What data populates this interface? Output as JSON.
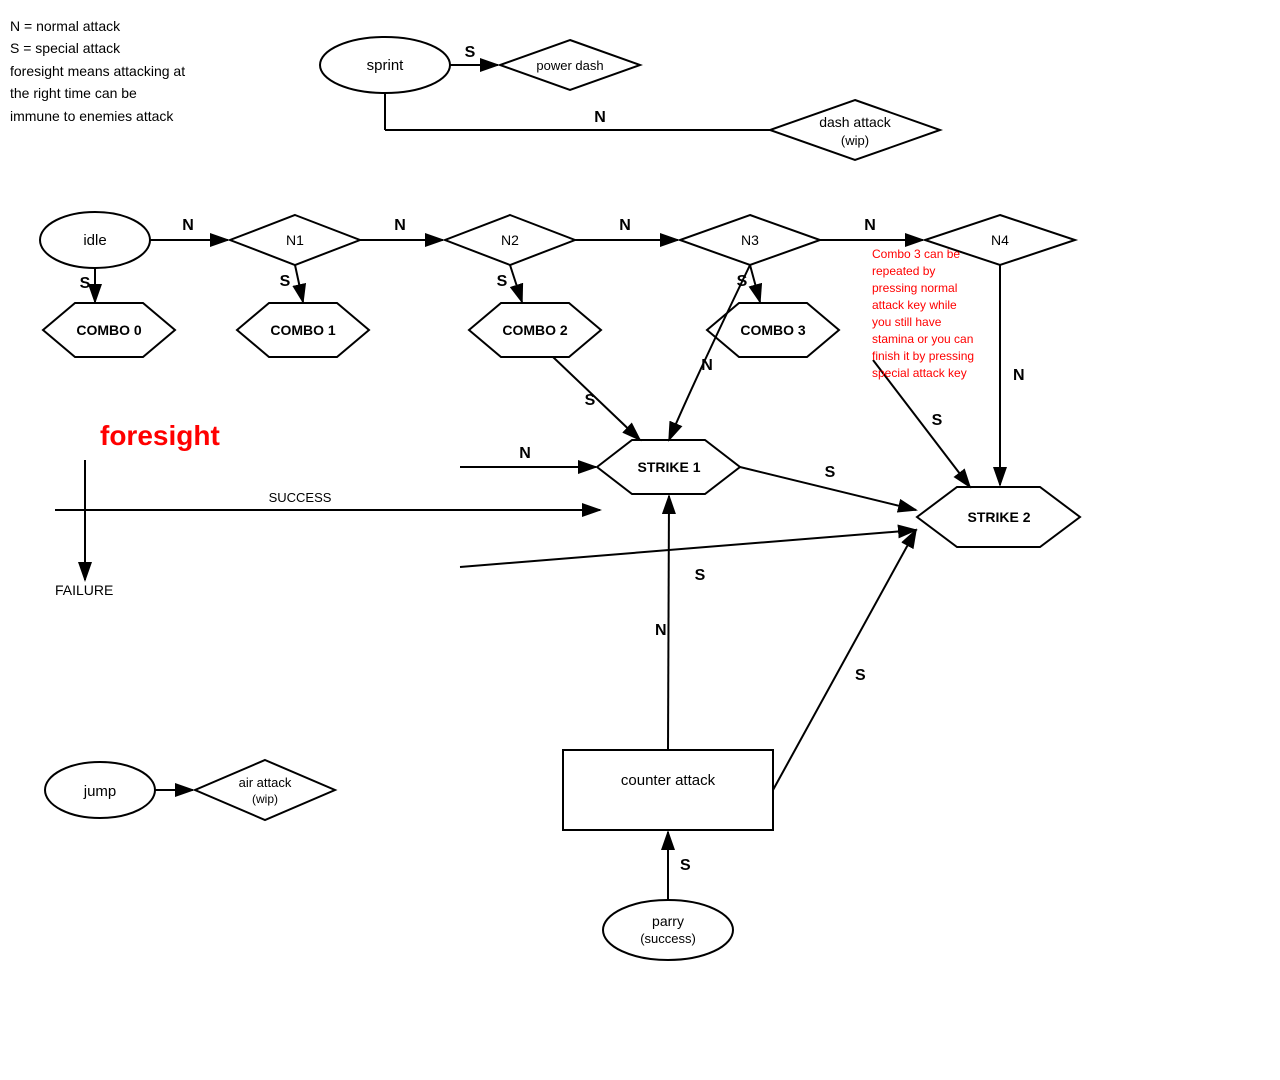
{
  "legend": {
    "lines": [
      "N = normal attack",
      "S = special attack",
      "foresight means attacking at",
      "the right time can be",
      "immune to enemies attack"
    ]
  },
  "nodes": {
    "sprint": "sprint",
    "power_dash": "power dash",
    "dash_attack": "dash attack\n(wip)",
    "idle": "idle",
    "n1": "N1",
    "n2": "N2",
    "n3": "N3",
    "n4": "N4",
    "combo0": "COMBO 0",
    "combo1": "COMBO 1",
    "combo2": "COMBO 2",
    "combo3": "COMBO 3",
    "foresight": "foresight",
    "success": "SUCCESS",
    "failure": "FAILURE",
    "strike1": "STRIKE 1",
    "strike2": "STRIKE 2",
    "jump": "jump",
    "air_attack": "air attack\n(wip)",
    "counter_attack": "counter attack",
    "parry": "parry\n(success)"
  },
  "combo3_note": "Combo 3 can be repeated by pressing normal attack key while you still have stamina or you can finish it by pressing special attack key"
}
